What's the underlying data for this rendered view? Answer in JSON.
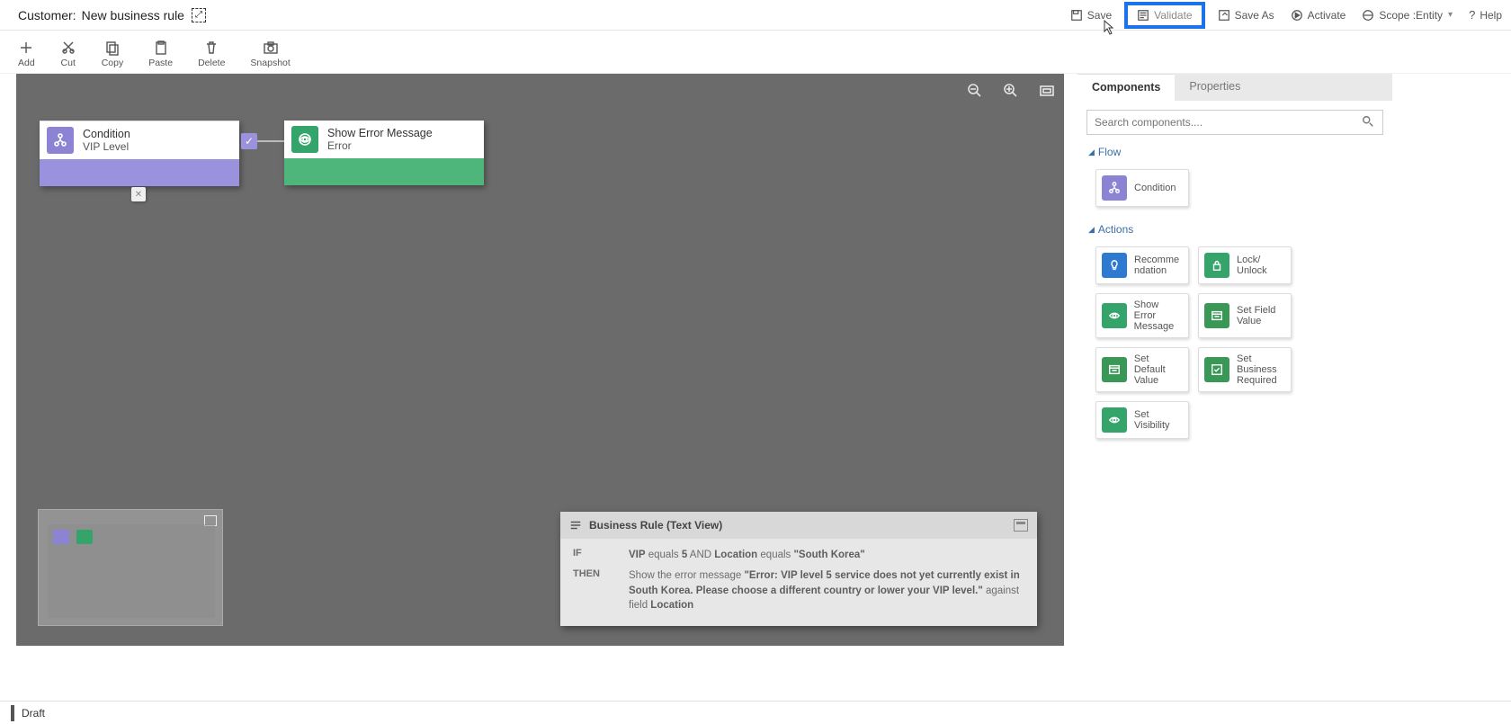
{
  "title": {
    "prefix": "Customer:",
    "name": "New business rule"
  },
  "topcmds": {
    "save": "Save",
    "validate": "Validate",
    "saveas": "Save As",
    "activate": "Activate",
    "scope_label": "Scope :",
    "scope_value": "Entity",
    "help": "Help"
  },
  "toolbar": {
    "add": "Add",
    "cut": "Cut",
    "copy": "Copy",
    "paste": "Paste",
    "delete": "Delete",
    "snapshot": "Snapshot"
  },
  "nodes": {
    "condition": {
      "title": "Condition",
      "sub": "VIP Level"
    },
    "action": {
      "title": "Show Error Message",
      "sub": "Error"
    }
  },
  "textview": {
    "header": "Business Rule (Text View)",
    "if_kw": "IF",
    "then_kw": "THEN",
    "if_plain1": " equals ",
    "if_bold1": "VIP",
    "if_bold2": "5",
    "if_and": " AND ",
    "if_bold3": "Location",
    "if_plain2": " equals ",
    "if_bold4": "\"South Korea\"",
    "then_plain1": "Show the error message ",
    "then_bold1": "\"Error: VIP level 5 service does not yet currently exist in South Korea. Please choose a different country or lower your VIP level.\"",
    "then_plain2": " against field ",
    "then_bold2": "Location"
  },
  "side": {
    "tab_components": "Components",
    "tab_properties": "Properties",
    "search_placeholder": "Search components....",
    "grp_flow": "Flow",
    "grp_actions": "Actions",
    "tiles": {
      "condition": "Condition",
      "recommendation": "Recomme\nndation",
      "lock": "Lock/\nUnlock",
      "showerr": "Show Error\nMessage",
      "setfield": "Set Field\nValue",
      "setdefault": "Set Default\nValue",
      "setbiz": "Set\nBusiness\nRequired",
      "setvis": "Set\nVisibility"
    }
  },
  "status": "Draft"
}
